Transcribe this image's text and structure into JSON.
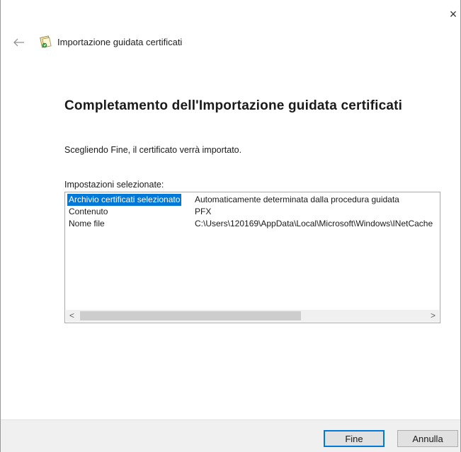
{
  "window": {
    "close_glyph": "×",
    "back_glyph": "←",
    "wizard_title": "Importazione guidata certificati",
    "wizard_icon": "certificate-icon"
  },
  "page": {
    "heading": "Completamento dell'Importazione guidata certificati",
    "description": "Scegliendo Fine, il certificato verrà importato.",
    "settings_label": "Impostazioni selezionate:"
  },
  "settings": {
    "rows": [
      {
        "key": "Archivio certificati selezionato",
        "value": "Automaticamente determinata dalla procedura guidata",
        "selected": true
      },
      {
        "key": "Contenuto",
        "value": "PFX",
        "selected": false
      },
      {
        "key": "Nome file",
        "value": "C:\\Users\\120169\\AppData\\Local\\Microsoft\\Windows\\INetCache",
        "selected": false
      }
    ],
    "scroll_left_glyph": "<",
    "scroll_right_glyph": ">"
  },
  "footer": {
    "finish_label": "Fine",
    "cancel_label": "Annulla"
  },
  "colors": {
    "selection": "#0078d7",
    "footer_bg": "#f0f0f0"
  }
}
